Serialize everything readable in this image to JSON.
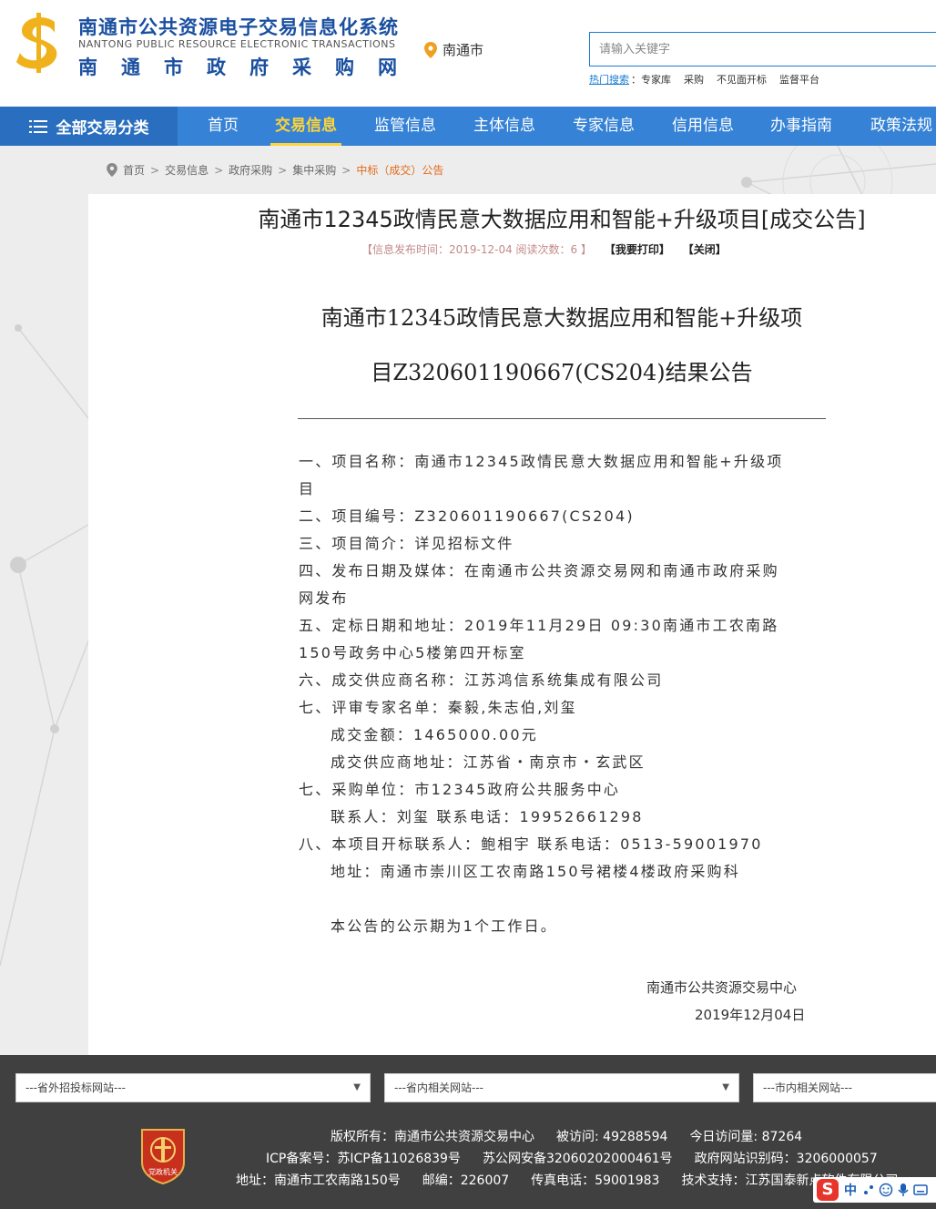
{
  "header": {
    "title_cn": "南通市公共资源电子交易信息化系统",
    "title_en": "NANTONG PUBLIC RESOURCE ELECTRONIC TRANSACTIONS",
    "subtitle_chars": [
      "南",
      "通",
      "市",
      "政",
      "府",
      "采",
      "购",
      "网"
    ],
    "location": "南通市",
    "search_placeholder": "请输入关键字",
    "hot_label": "热门搜索",
    "hot_items": [
      "：专家库",
      "采购",
      "不见面开标",
      "监督平台"
    ]
  },
  "nav": {
    "all_label": "全部交易分类",
    "items": [
      "首页",
      "交易信息",
      "监管信息",
      "主体信息",
      "专家信息",
      "信用信息",
      "办事指南",
      "政策法规"
    ],
    "active_index": 1
  },
  "breadcrumb": {
    "items": [
      "首页",
      "交易信息",
      "政府采购",
      "集中采购"
    ],
    "current": "中标（成交）公告"
  },
  "article": {
    "title": "南通市12345政情民意大数据应用和智能+升级项目[成交公告]",
    "meta": "【信息发布时间：2019-12-04 阅读次数：6 】",
    "print_label": "【我要打印】",
    "close_label": "【关闭】",
    "doc_title_lines": [
      "南通市12345政情民意大数据应用和智能+升级项",
      "目Z320601190667(CS204)结果公告"
    ],
    "body_lines": [
      "一、项目名称：南通市12345政情民意大数据应用和智能+升级项",
      "目",
      "二、项目编号：Z320601190667(CS204)",
      "三、项目简介：详见招标文件",
      "四、发布日期及媒体：在南通市公共资源交易网和南通市政府采购",
      "网发布",
      "五、定标日期和地址：2019年11月29日 09:30南通市工农南路",
      "150号政务中心5楼第四开标室",
      "六、成交供应商名称：江苏鸿信系统集成有限公司",
      "七、评审专家名单：秦毅,朱志伯,刘玺",
      "成交金额：1465000.00元",
      "成交供应商地址：江苏省・南京市・玄武区",
      "七、采购单位：市12345政府公共服务中心",
      "联系人：刘玺   联系电话：19952661298",
      "八、本项目开标联系人：鲍相宇   联系电话：0513-59001970",
      "地址：南通市崇川区工农南路150号裙楼4楼政府采购科",
      "本公告的公示期为1个工作日。"
    ],
    "sign_org": "南通市公共资源交易中心",
    "sign_date": "2019年12月04日"
  },
  "footer": {
    "selects": [
      "---省外招投标网站---",
      "---省内相关网站---",
      "---市内相关网站---"
    ],
    "badge_text": "党政机关",
    "line1": [
      "版权所有：南通市公共资源交易中心",
      "被访问: 49288594",
      "今日访问量: 87264"
    ],
    "line2": [
      "ICP备案号：苏ICP备11026839号",
      "苏公网安备32060202000461号",
      "政府网站识别码：3206000057"
    ],
    "line3": [
      "地址：南通市工农南路150号",
      "邮编：226007",
      "传真电话：59001983",
      "技术支持：江苏国泰新点软件有限公司"
    ],
    "ime_text": "中"
  },
  "colors": {
    "brand_blue": "#1a4fa0",
    "nav_blue": "#3682d6",
    "active_yellow": "#ffd33a",
    "breadcrumb_current": "#e46b1e",
    "footer_bg": "#404040"
  }
}
